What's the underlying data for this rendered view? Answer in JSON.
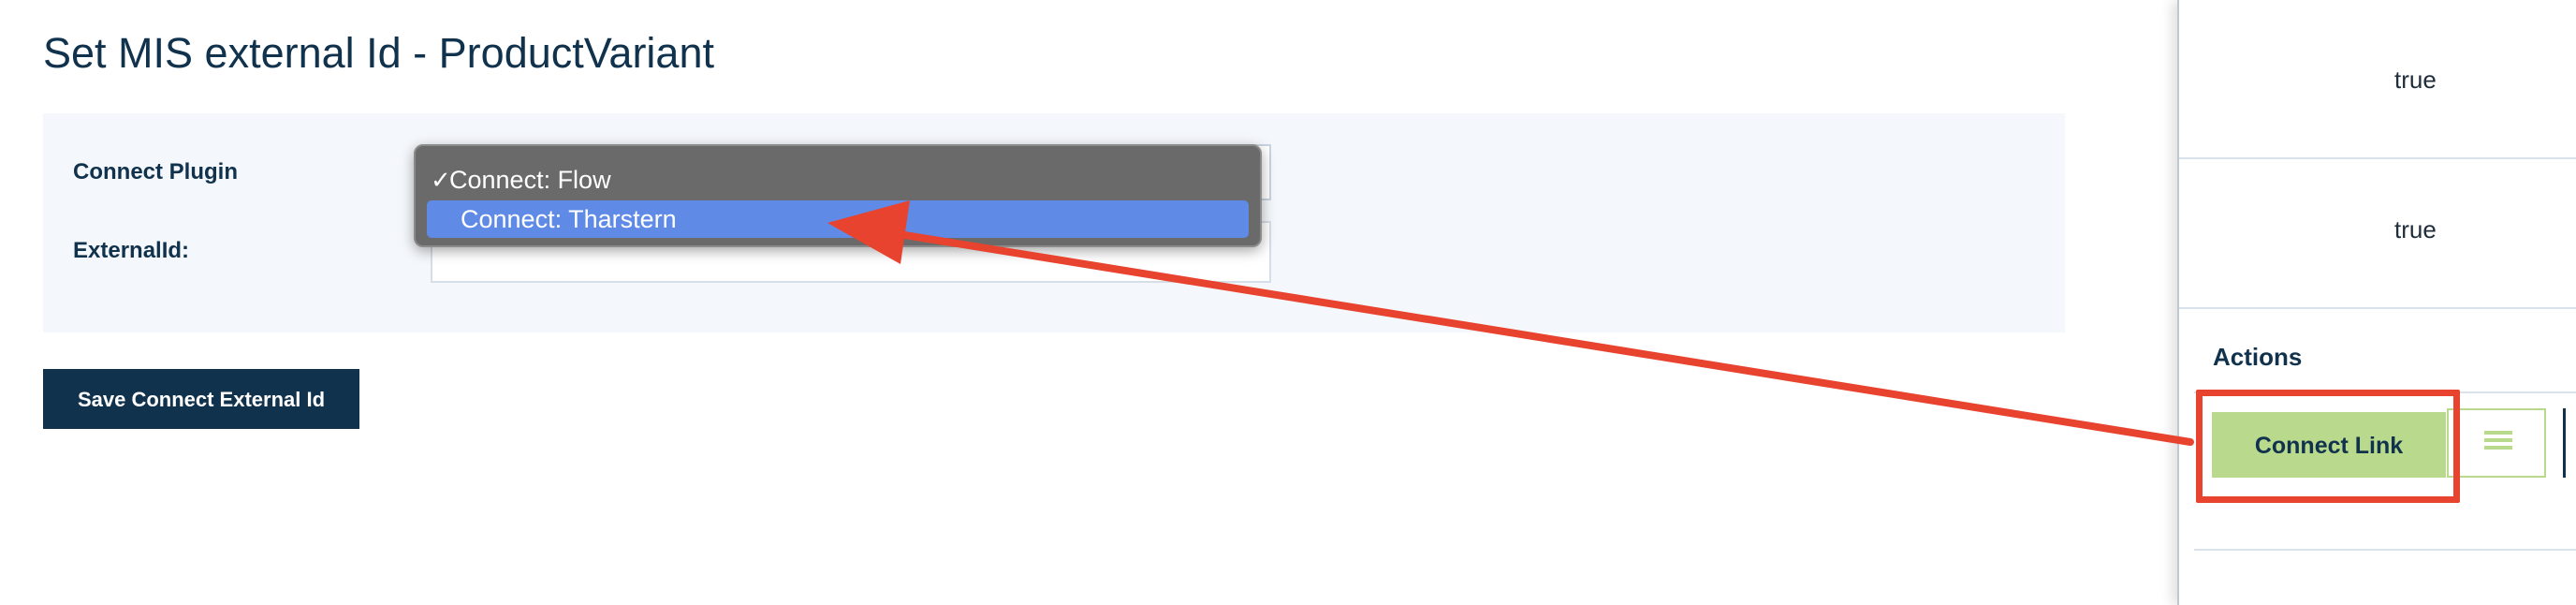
{
  "page": {
    "title": "Set MIS external Id - ProductVariant"
  },
  "form": {
    "connect_plugin_label": "Connect Plugin",
    "external_id_label": "ExternalId:",
    "external_id_value": "",
    "dropdown": {
      "selected": "Connect: Flow",
      "check_glyph": "✓",
      "options": [
        {
          "label": "Connect: Flow",
          "selected": true
        },
        {
          "label": "Connect: Tharstern",
          "highlighted": true
        }
      ]
    },
    "save_label": "Save Connect External Id"
  },
  "side_panel": {
    "rows": [
      {
        "value": "true"
      },
      {
        "value": "true"
      }
    ],
    "actions_label": "Actions",
    "connect_link_label": "Connect Link",
    "list_icon": "list-icon"
  },
  "annotation": {
    "color": "#e8432e"
  },
  "colors": {
    "primary": "#11324d",
    "accent_green": "#b9d98c",
    "dropdown_highlight": "#5f8be6",
    "panel_bg": "#f4f7fb"
  }
}
